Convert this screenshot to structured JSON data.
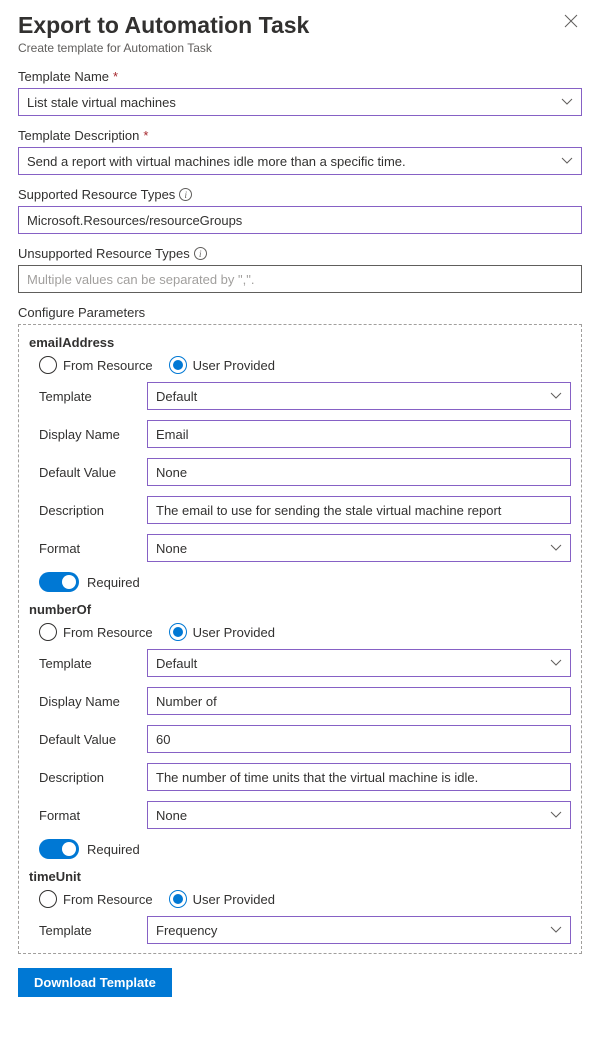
{
  "header": {
    "title": "Export to Automation Task",
    "subtitle": "Create template for Automation Task"
  },
  "fields": {
    "templateName": {
      "label": "Template Name",
      "required": true,
      "value": "List stale virtual machines"
    },
    "templateDescription": {
      "label": "Template Description",
      "required": true,
      "value": "Send a report with virtual machines idle more than a specific time."
    },
    "supportedTypes": {
      "label": "Supported Resource Types",
      "value": "Microsoft.Resources/resourceGroups"
    },
    "unsupportedTypes": {
      "label": "Unsupported Resource Types",
      "placeholder": "Multiple values can be separated by \",\"."
    }
  },
  "paramsLabel": "Configure Parameters",
  "radioLabels": {
    "fromResource": "From Resource",
    "userProvided": "User Provided"
  },
  "rowLabels": {
    "template": "Template",
    "displayName": "Display Name",
    "defaultValue": "Default Value",
    "description": "Description",
    "format": "Format",
    "required": "Required"
  },
  "params": [
    {
      "key": "emailAddress",
      "source": "userProvided",
      "template": "Default",
      "displayName": "Email",
      "defaultValue": "None",
      "description": "The email to use for sending the stale virtual machine report",
      "format": "None",
      "required": true
    },
    {
      "key": "numberOf",
      "source": "userProvided",
      "template": "Default",
      "displayName": "Number of",
      "defaultValue": "60",
      "description": "The number of time units that the virtual machine is idle.",
      "format": "None",
      "required": true
    },
    {
      "key": "timeUnit",
      "source": "userProvided",
      "template": "Frequency"
    }
  ],
  "downloadLabel": "Download Template"
}
